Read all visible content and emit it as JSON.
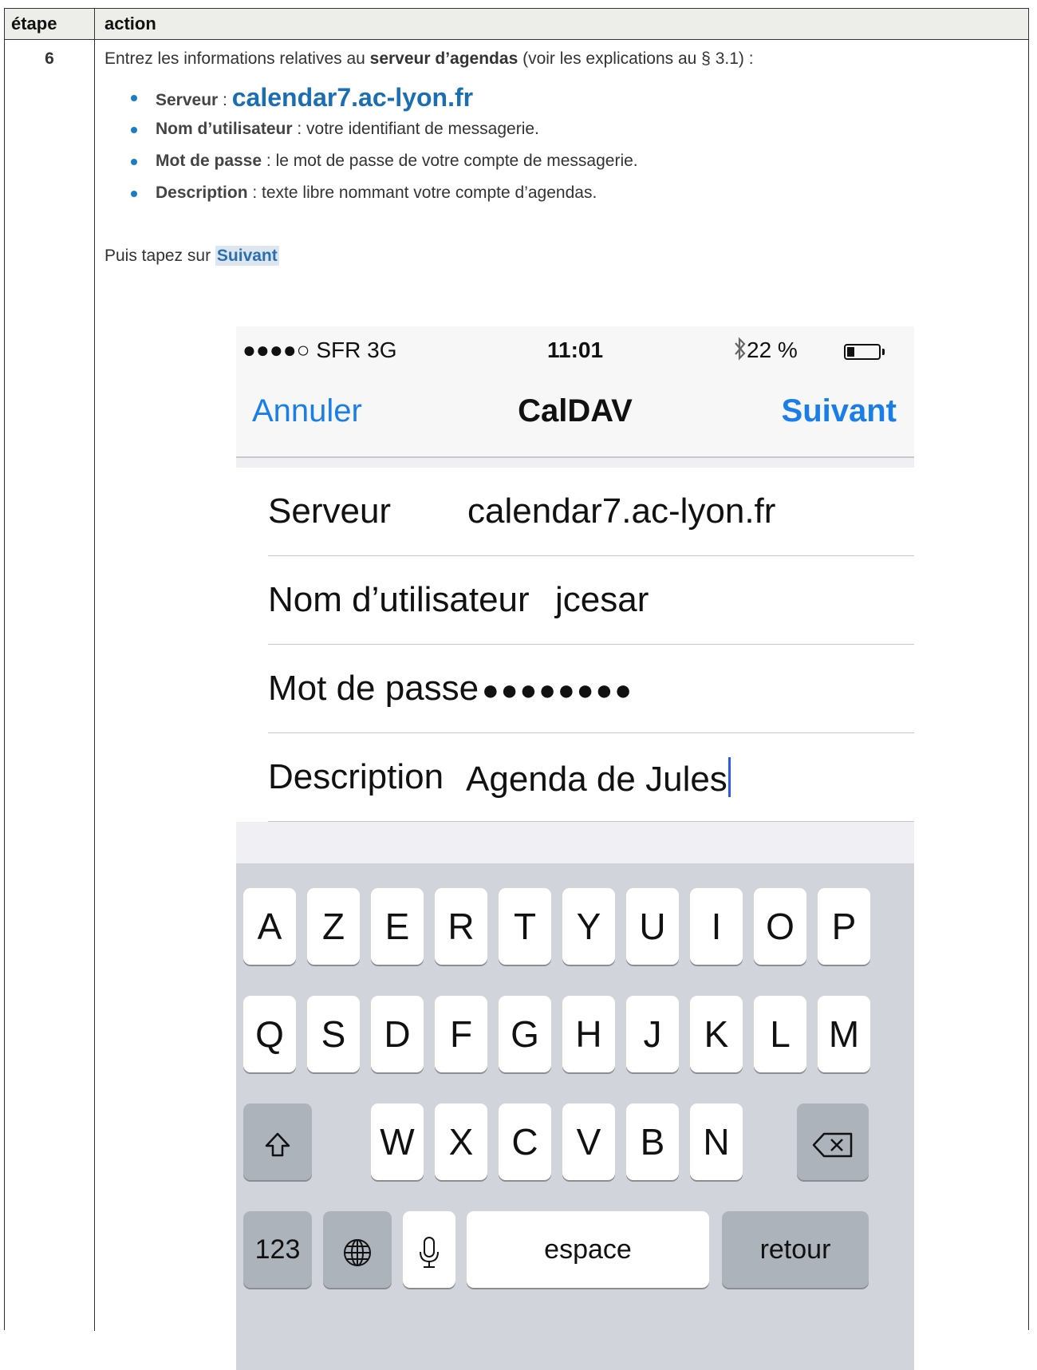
{
  "table": {
    "header_step": "étape",
    "header_action": "action"
  },
  "step": {
    "number": "6",
    "intro_prefix": "Entrez les informations relatives au ",
    "intro_bold": "serveur d’agendas",
    "intro_suffix": " (voir les explications au § 3.1) :",
    "bullets": [
      {
        "label": "Serveur",
        "sep": " : ",
        "value": "calendar7.ac-lyon.fr"
      },
      {
        "label": "Nom d’utilisateur",
        "sep": " : ",
        "value": "votre identifiant de messagerie."
      },
      {
        "label": "Mot de passe",
        "sep": " : ",
        "value": "le mot de passe de votre compte de messagerie."
      },
      {
        "label": "Description",
        "sep": " : ",
        "value": "texte libre nommant votre compte d’agendas."
      }
    ],
    "then_prefix": "Puis tapez sur ",
    "then_button": "Suivant"
  },
  "phone": {
    "status": {
      "carrier": "●●●●○ SFR  3G",
      "time": "11:01",
      "battery": "22 %",
      "bluetooth_icon": "bluetooth-icon",
      "battery_level": 0.22
    },
    "nav": {
      "left": "Annuler",
      "title": "CalDAV",
      "right": "Suivant"
    },
    "form": [
      {
        "label": "Serveur",
        "value": "calendar7.ac-lyon.fr"
      },
      {
        "label": "Nom d’utilisateur",
        "value": "jcesar"
      },
      {
        "label": "Mot de passe",
        "value": "●●●●●●●●"
      },
      {
        "label": "Description",
        "value": "Agenda de Jules"
      }
    ],
    "keyboard": {
      "row1": [
        "A",
        "Z",
        "E",
        "R",
        "T",
        "Y",
        "U",
        "I",
        "O",
        "P"
      ],
      "row2": [
        "Q",
        "S",
        "D",
        "F",
        "G",
        "H",
        "J",
        "K",
        "L",
        "M"
      ],
      "row3": [
        "W",
        "X",
        "C",
        "V",
        "B",
        "N"
      ],
      "numbers": "123",
      "space": "espace",
      "return": "retour",
      "shift_icon": "shift-icon",
      "globe_icon": "globe-icon",
      "mic_icon": "microphone-icon",
      "delete_icon": "delete-icon"
    }
  }
}
